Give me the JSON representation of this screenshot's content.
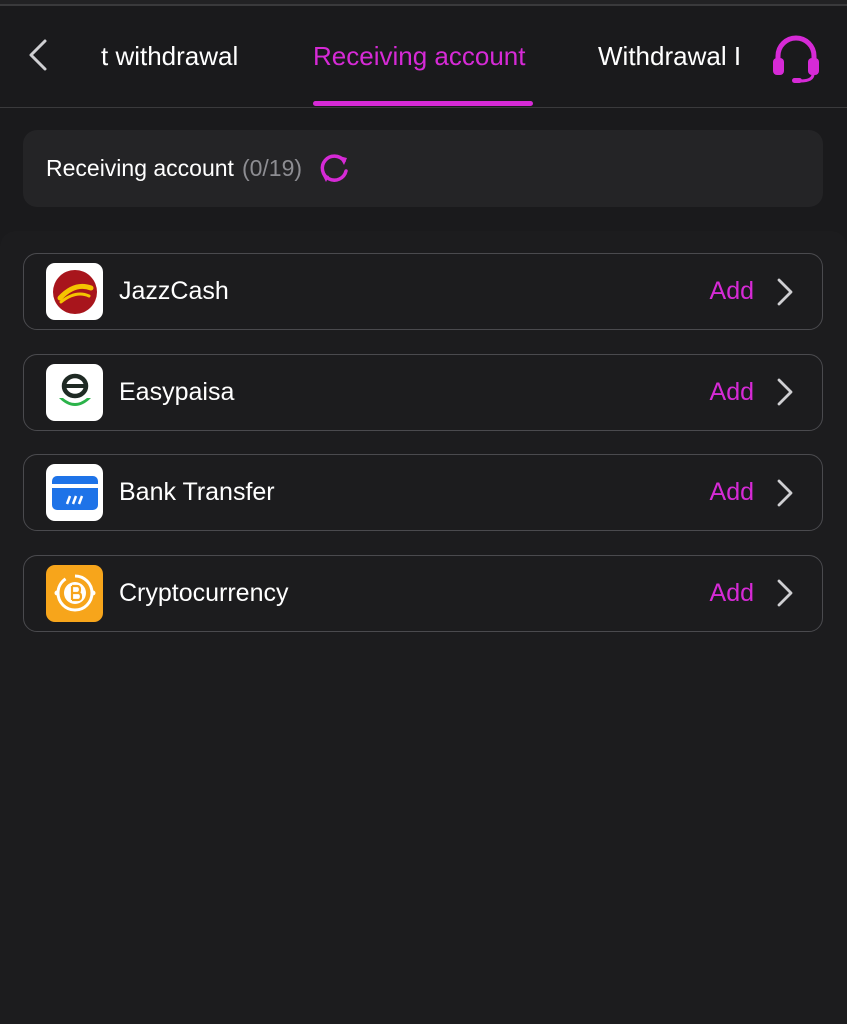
{
  "header": {
    "tabs": [
      {
        "label": "t withdrawal",
        "active": false
      },
      {
        "label": "Receiving account",
        "active": true
      },
      {
        "label": "Withdrawal I",
        "active": false
      }
    ],
    "back_icon": "chevron-left-icon",
    "support_icon": "headset-icon"
  },
  "summary": {
    "title": "Receiving account",
    "count": "(0/19)",
    "refresh_icon": "refresh-icon"
  },
  "accounts": [
    {
      "label": "JazzCash",
      "action": "Add",
      "icon": "jazzcash-logo-icon"
    },
    {
      "label": "Easypaisa",
      "action": "Add",
      "icon": "easypaisa-logo-icon"
    },
    {
      "label": "Bank Transfer",
      "action": "Add",
      "icon": "bank-card-icon"
    },
    {
      "label": "Cryptocurrency",
      "action": "Add",
      "icon": "bitcoin-icon"
    }
  ],
  "colors": {
    "accent": "#d62ad6",
    "background": "#1a1a1c",
    "card": "#242426",
    "border": "#4a4a4e",
    "muted_text": "#8d8d92"
  }
}
